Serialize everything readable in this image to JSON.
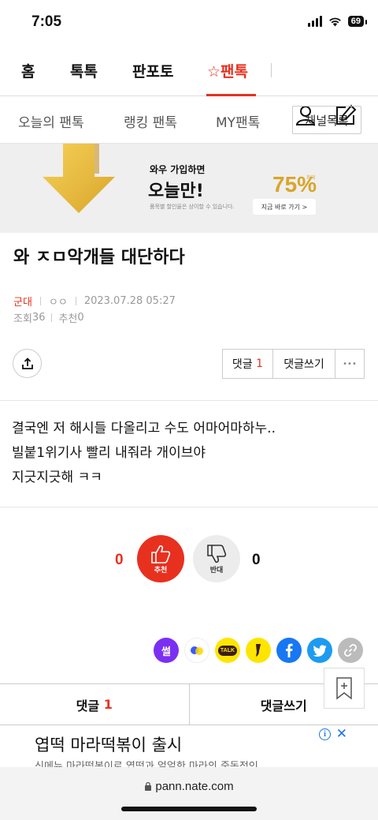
{
  "status": {
    "time": "7:05",
    "battery": "69"
  },
  "main_nav": {
    "home": "홈",
    "toktok": "톡톡",
    "panpoto": "판포토",
    "pantok": "☆팬톡"
  },
  "sub_nav": {
    "today": "오늘의 팬톡",
    "ranking": "랭킹 팬톡",
    "my": "MY팬톡",
    "channel_list": "채널목록"
  },
  "ad_banner": {
    "line1": "와우 가입하면",
    "line2": "오늘만!",
    "fine_print": "품목별 할인율은 상이할 수 있습니다.",
    "percent": "75%",
    "tag": "최대",
    "cta": "지금 바로 가기 >"
  },
  "post": {
    "title": "와 ㅈㅁ악개들 대단하다",
    "category": "군대",
    "author": "ㅇㅇ",
    "date": "2023.07.28 05:27",
    "views_label": "조회",
    "views": "36",
    "recommend_label": "추천",
    "recommend": "0",
    "body": [
      "결국엔 저 해시들 다올리고 수도 어마어마하누..",
      "빌붙1위기사 빨리 내줘라 개이브야",
      "지긋지긋해 ㅋㅋ"
    ]
  },
  "actions": {
    "comment_label": "댓글",
    "comment_count": "1",
    "write_comment": "댓글쓰기",
    "more": "•••"
  },
  "vote": {
    "up_count": "0",
    "up_label": "추천",
    "down_label": "반대",
    "down_count": "0"
  },
  "social": {
    "ssul": "썰",
    "kakao_talk": "TALK"
  },
  "bottom_tabs": {
    "comments_label": "댓글",
    "comments_count": "1",
    "write": "댓글쓰기"
  },
  "bottom_ad": {
    "title": "엽떡 마라떡볶이 출시",
    "subtitle": "신메뉴 마라떡볶이로 엽떡과 얼얼한 마라의 중독적인"
  },
  "url": "pann.nate.com",
  "colors": {
    "accent": "#e8301f",
    "kakao": "#fee500",
    "facebook": "#1877f2",
    "twitter": "#1d9bf0"
  }
}
